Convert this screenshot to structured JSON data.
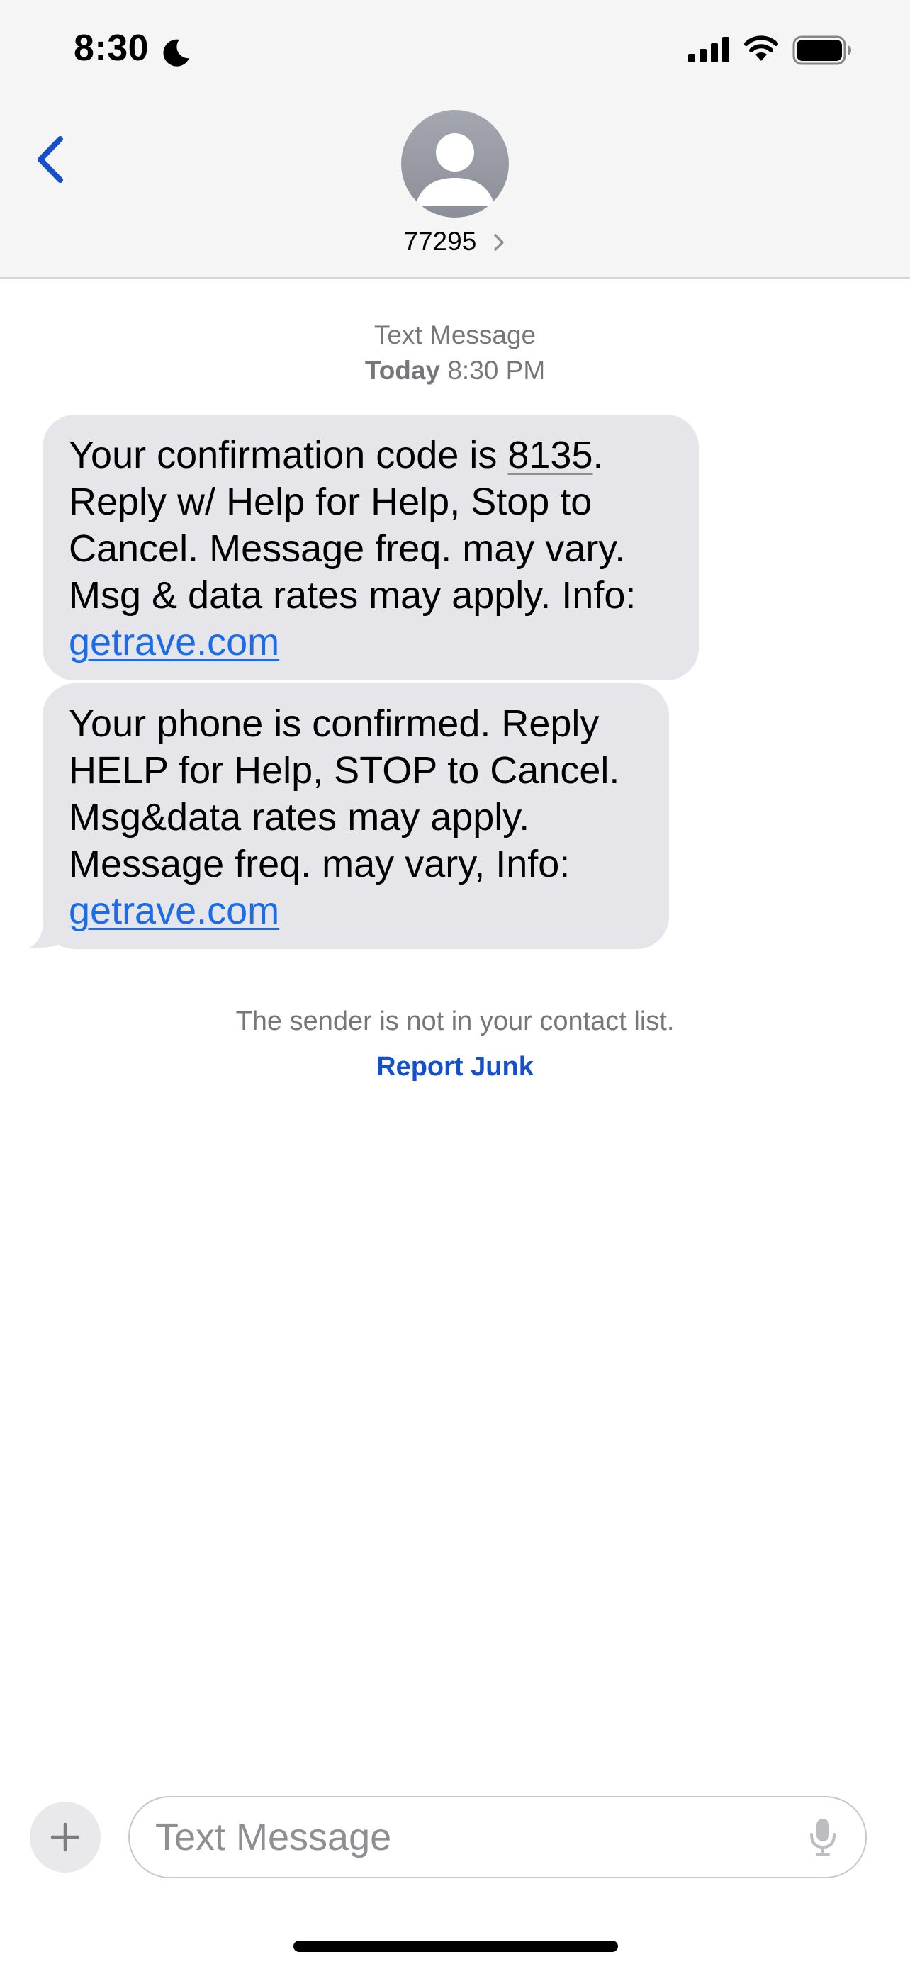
{
  "status_bar": {
    "time": "8:30",
    "icons": [
      "moon-icon",
      "signal-icon",
      "wifi-icon",
      "battery-icon"
    ]
  },
  "header": {
    "back_icon": "chevron-left-icon",
    "avatar_icon": "person-silhouette-icon",
    "contact_name": "77295",
    "accent_color": "#1550c8"
  },
  "conversation": {
    "service_label": "Text Message",
    "timestamp_day": "Today",
    "timestamp_time": "8:30 PM",
    "messages": [
      {
        "line1_prefix": "Your confirmation code is ",
        "code": "8135",
        "line1_suffix": ".",
        "line2": "Reply w/ Help for Help, Stop to",
        "line3": "Cancel.  Message freq. may vary.",
        "line4": "Msg & data rates may apply. Info:",
        "link": "getrave.com"
      },
      {
        "line1": "Your phone is confirmed. Reply",
        "line2": "HELP for Help, STOP to Cancel.",
        "line3": "Msg&data rates may apply.",
        "line4": "Message freq. may vary, Info:",
        "link": "getrave.com"
      }
    ],
    "bubble_color": "#e5e5ea",
    "link_color": "#1a6ce8",
    "sender_note": "The sender is not in your contact list.",
    "report_junk_label": "Report Junk"
  },
  "composer": {
    "plus_icon": "plus-icon",
    "placeholder": "Text Message",
    "value": "",
    "mic_icon": "microphone-icon"
  }
}
